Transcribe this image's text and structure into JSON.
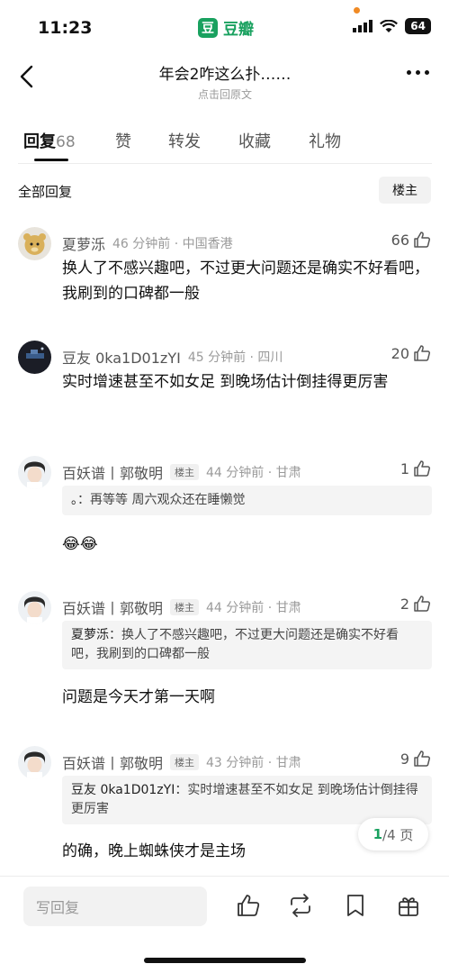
{
  "status": {
    "time": "11:23",
    "app_logo": "豆",
    "app_name": "豆瓣",
    "battery": "64"
  },
  "header": {
    "title": "年会2咋这么扑……",
    "subtitle": "点击回原文"
  },
  "tabs": [
    {
      "label": "回复",
      "count": "68"
    },
    {
      "label": "赞"
    },
    {
      "label": "转发"
    },
    {
      "label": "收藏"
    },
    {
      "label": "礼物"
    }
  ],
  "filter": {
    "label": "全部回复",
    "op_button": "楼主"
  },
  "comments": [
    {
      "author": "夏萝泺",
      "time": "46 分钟前 · 中国香港",
      "likes": "66",
      "text": "换人了不感兴趣吧，不过更大问题还是确实不好看吧，我刷到的口碑都一般"
    },
    {
      "author": "豆友 0ka1D01zYI",
      "time": "45 分钟前 · 四川",
      "likes": "20",
      "text": "实时增速甚至不如女足 到晚场估计倒挂得更厉害"
    },
    {
      "author": "百妖谱丨郭敬明",
      "badge": "楼主",
      "time": "44 分钟前 · 甘肃",
      "likes": "1",
      "quote_author": "。",
      "quote_text": "：再等等 周六观众还在睡懒觉",
      "text": "😂😂"
    },
    {
      "author": "百妖谱丨郭敬明",
      "badge": "楼主",
      "time": "44 分钟前 · 甘肃",
      "likes": "2",
      "quote_author": "夏萝泺",
      "quote_text": "：换人了不感兴趣吧，不过更大问题还是确实不好看吧，我刷到的口碑都一般",
      "text": "问题是今天才第一天啊"
    },
    {
      "author": "百妖谱丨郭敬明",
      "badge": "楼主",
      "time": "43 分钟前 · 甘肃",
      "likes": "9",
      "quote_author": "豆友 0ka1D01zYI",
      "quote_text": "：实时增速甚至不如女足 到晚场估计倒挂得更厉害",
      "text": "的确，晚上蜘蛛侠才是主场"
    }
  ],
  "pagination": {
    "current": "1",
    "total": "/4 页"
  },
  "bottom_bar": {
    "reply_placeholder": "写回复",
    "icons": [
      "thumbs-up-icon",
      "repost-icon",
      "bookmark-icon",
      "gift-icon"
    ]
  },
  "colors": {
    "brand_green": "#19a15f",
    "text_primary": "#111111",
    "text_secondary": "#9a9a9a"
  }
}
